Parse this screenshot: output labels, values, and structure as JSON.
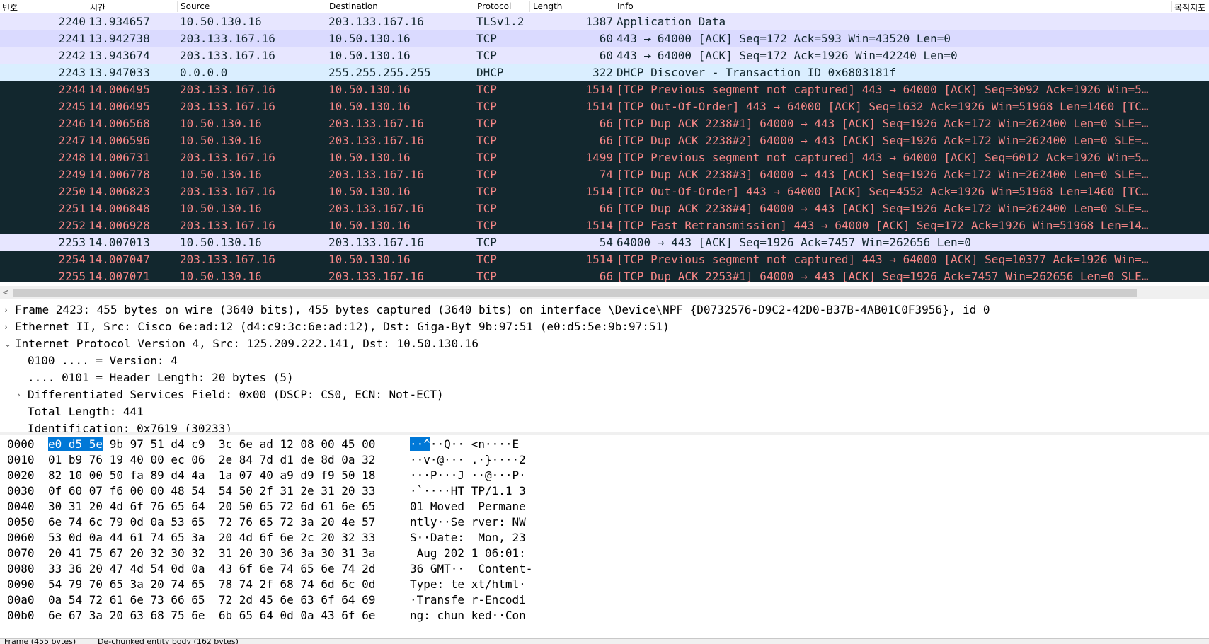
{
  "columns": {
    "no": "번호",
    "time": "시간",
    "source": "Source",
    "destination": "Destination",
    "protocol": "Protocol",
    "length": "Length",
    "info": "Info",
    "extra": "목적지포"
  },
  "packets": [
    {
      "no": "2240",
      "time": "13.934657",
      "src": "10.50.130.16",
      "dst": "203.133.167.16",
      "proto": "TLSv1.2",
      "len": "1387",
      "info": "Application Data",
      "style": "tls"
    },
    {
      "no": "2241",
      "time": "13.942738",
      "src": "203.133.167.16",
      "dst": "10.50.130.16",
      "proto": "TCP",
      "len": "60",
      "info": "443 → 64000 [ACK] Seq=172 Ack=593 Win=43520 Len=0",
      "style": "tcp"
    },
    {
      "no": "2242",
      "time": "13.943674",
      "src": "203.133.167.16",
      "dst": "10.50.130.16",
      "proto": "TCP",
      "len": "60",
      "info": "443 → 64000 [ACK] Seq=172 Ack=1926 Win=42240 Len=0",
      "style": "tcp2"
    },
    {
      "no": "2243",
      "time": "13.947033",
      "src": "0.0.0.0",
      "dst": "255.255.255.255",
      "proto": "DHCP",
      "len": "322",
      "info": "DHCP Discover - Transaction ID 0x6803181f",
      "style": "dhcp"
    },
    {
      "no": "2244",
      "time": "14.006495",
      "src": "203.133.167.16",
      "dst": "10.50.130.16",
      "proto": "TCP",
      "len": "1514",
      "info": "[TCP Previous segment not captured] 443 → 64000 [ACK] Seq=3092 Ack=1926 Win=5…",
      "style": "bad"
    },
    {
      "no": "2245",
      "time": "14.006495",
      "src": "203.133.167.16",
      "dst": "10.50.130.16",
      "proto": "TCP",
      "len": "1514",
      "info": "[TCP Out-Of-Order] 443 → 64000 [ACK] Seq=1632 Ack=1926 Win=51968 Len=1460 [TC…",
      "style": "bad"
    },
    {
      "no": "2246",
      "time": "14.006568",
      "src": "10.50.130.16",
      "dst": "203.133.167.16",
      "proto": "TCP",
      "len": "66",
      "info": "[TCP Dup ACK 2238#1] 64000 → 443 [ACK] Seq=1926 Ack=172 Win=262400 Len=0 SLE=…",
      "style": "bad"
    },
    {
      "no": "2247",
      "time": "14.006596",
      "src": "10.50.130.16",
      "dst": "203.133.167.16",
      "proto": "TCP",
      "len": "66",
      "info": "[TCP Dup ACK 2238#2] 64000 → 443 [ACK] Seq=1926 Ack=172 Win=262400 Len=0 SLE=…",
      "style": "bad"
    },
    {
      "no": "2248",
      "time": "14.006731",
      "src": "203.133.167.16",
      "dst": "10.50.130.16",
      "proto": "TCP",
      "len": "1499",
      "info": "[TCP Previous segment not captured] 443 → 64000 [ACK] Seq=6012 Ack=1926 Win=5…",
      "style": "bad"
    },
    {
      "no": "2249",
      "time": "14.006778",
      "src": "10.50.130.16",
      "dst": "203.133.167.16",
      "proto": "TCP",
      "len": "74",
      "info": "[TCP Dup ACK 2238#3] 64000 → 443 [ACK] Seq=1926 Ack=172 Win=262400 Len=0 SLE=…",
      "style": "bad"
    },
    {
      "no": "2250",
      "time": "14.006823",
      "src": "203.133.167.16",
      "dst": "10.50.130.16",
      "proto": "TCP",
      "len": "1514",
      "info": "[TCP Out-Of-Order] 443 → 64000 [ACK] Seq=4552 Ack=1926 Win=51968 Len=1460 [TC…",
      "style": "bad"
    },
    {
      "no": "2251",
      "time": "14.006848",
      "src": "10.50.130.16",
      "dst": "203.133.167.16",
      "proto": "TCP",
      "len": "66",
      "info": "[TCP Dup ACK 2238#4] 64000 → 443 [ACK] Seq=1926 Ack=172 Win=262400 Len=0 SLE=…",
      "style": "bad"
    },
    {
      "no": "2252",
      "time": "14.006928",
      "src": "203.133.167.16",
      "dst": "10.50.130.16",
      "proto": "TCP",
      "len": "1514",
      "info": "[TCP Fast Retransmission] 443 → 64000 [ACK] Seq=172 Ack=1926 Win=51968 Len=14…",
      "style": "bad"
    },
    {
      "no": "2253",
      "time": "14.007013",
      "src": "10.50.130.16",
      "dst": "203.133.167.16",
      "proto": "TCP",
      "len": "54",
      "info": "64000 → 443 [ACK] Seq=1926 Ack=7457 Win=262656 Len=0",
      "style": "tcp2"
    },
    {
      "no": "2254",
      "time": "14.007047",
      "src": "203.133.167.16",
      "dst": "10.50.130.16",
      "proto": "TCP",
      "len": "1514",
      "info": "[TCP Previous segment not captured] 443 → 64000 [ACK] Seq=10377 Ack=1926 Win=…",
      "style": "bad"
    },
    {
      "no": "2255",
      "time": "14.007071",
      "src": "10.50.130.16",
      "dst": "203.133.167.16",
      "proto": "TCP",
      "len": "66",
      "info": "[TCP Dup ACK 2253#1] 64000 → 443 [ACK] Seq=1926 Ack=7457 Win=262656 Len=0 SLE…",
      "style": "bad"
    }
  ],
  "scrollbar": {
    "left_arrow": "<"
  },
  "details": [
    {
      "indent": 0,
      "toggle": "›",
      "text": "Frame 2423: 455 bytes on wire (3640 bits), 455 bytes captured (3640 bits) on interface \\Device\\NPF_{D0732576-D9C2-42D0-B37B-4AB01C0F3956}, id 0"
    },
    {
      "indent": 0,
      "toggle": "›",
      "text": "Ethernet II, Src: Cisco_6e:ad:12 (d4:c9:3c:6e:ad:12), Dst: Giga-Byt_9b:97:51 (e0:d5:5e:9b:97:51)"
    },
    {
      "indent": 0,
      "toggle": "⌄",
      "text": "Internet Protocol Version 4, Src: 125.209.222.141, Dst: 10.50.130.16"
    },
    {
      "indent": 1,
      "toggle": "",
      "text": "0100 .... = Version: 4"
    },
    {
      "indent": 1,
      "toggle": "",
      "text": ".... 0101 = Header Length: 20 bytes (5)"
    },
    {
      "indent": 1,
      "toggle": "›",
      "text": "Differentiated Services Field: 0x00 (DSCP: CS0, ECN: Not-ECT)"
    },
    {
      "indent": 1,
      "toggle": "",
      "text": "Total Length: 441"
    },
    {
      "indent": 1,
      "toggle": "",
      "text": "Identification: 0x7619 (30233)"
    }
  ],
  "hex": [
    {
      "off": "0000",
      "hl": "e0 d5 5e",
      "hex": " 9b 97 51 d4 c9  3c 6e ad 12 08 00 45 00",
      "hl_ascii": "··^",
      "ascii": "··Q·· <n····E"
    },
    {
      "off": "0010",
      "hl": "",
      "hex": "01 b9 76 19 40 00 ec 06  2e 84 7d d1 de 8d 0a 32",
      "hl_ascii": "",
      "ascii": "··v·@··· .·}····2"
    },
    {
      "off": "0020",
      "hl": "",
      "hex": "82 10 00 50 fa 89 d4 4a  1a 07 40 a9 d9 f9 50 18",
      "hl_ascii": "",
      "ascii": "···P···J ··@···P·"
    },
    {
      "off": "0030",
      "hl": "",
      "hex": "0f 60 07 f6 00 00 48 54  54 50 2f 31 2e 31 20 33",
      "hl_ascii": "",
      "ascii": "·`····HT TP/1.1 3"
    },
    {
      "off": "0040",
      "hl": "",
      "hex": "30 31 20 4d 6f 76 65 64  20 50 65 72 6d 61 6e 65",
      "hl_ascii": "",
      "ascii": "01 Moved  Permane"
    },
    {
      "off": "0050",
      "hl": "",
      "hex": "6e 74 6c 79 0d 0a 53 65  72 76 65 72 3a 20 4e 57",
      "hl_ascii": "",
      "ascii": "ntly··Se rver: NW"
    },
    {
      "off": "0060",
      "hl": "",
      "hex": "53 0d 0a 44 61 74 65 3a  20 4d 6f 6e 2c 20 32 33",
      "hl_ascii": "",
      "ascii": "S··Date:  Mon, 23"
    },
    {
      "off": "0070",
      "hl": "",
      "hex": "20 41 75 67 20 32 30 32  31 20 30 36 3a 30 31 3a",
      "hl_ascii": "",
      "ascii": " Aug 202 1 06:01:"
    },
    {
      "off": "0080",
      "hl": "",
      "hex": "33 36 20 47 4d 54 0d 0a  43 6f 6e 74 65 6e 74 2d",
      "hl_ascii": "",
      "ascii": "36 GMT··  Content-"
    },
    {
      "off": "0090",
      "hl": "",
      "hex": "54 79 70 65 3a 20 74 65  78 74 2f 68 74 6d 6c 0d",
      "hl_ascii": "",
      "ascii": "Type: te xt/html·"
    },
    {
      "off": "00a0",
      "hl": "",
      "hex": "0a 54 72 61 6e 73 66 65  72 2d 45 6e 63 6f 64 69",
      "hl_ascii": "",
      "ascii": "·Transfe r-Encodi"
    },
    {
      "off": "00b0",
      "hl": "",
      "hex": "6e 67 3a 20 63 68 75 6e  6b 65 64 0d 0a 43 6f 6e",
      "hl_ascii": "",
      "ascii": "ng: chun ked··Con"
    }
  ],
  "status": {
    "frame_tab": "Frame (455 bytes)",
    "dechunked_tab": "De-chunked entity body (162 bytes)"
  },
  "colors": {
    "tls_bg": "#e7e6ff",
    "tcp_bg": "#dadaff",
    "dhcp_bg": "#daeeff",
    "bad_bg": "#12272e",
    "bad_fg": "#f78787",
    "selection": "#0078d7"
  }
}
